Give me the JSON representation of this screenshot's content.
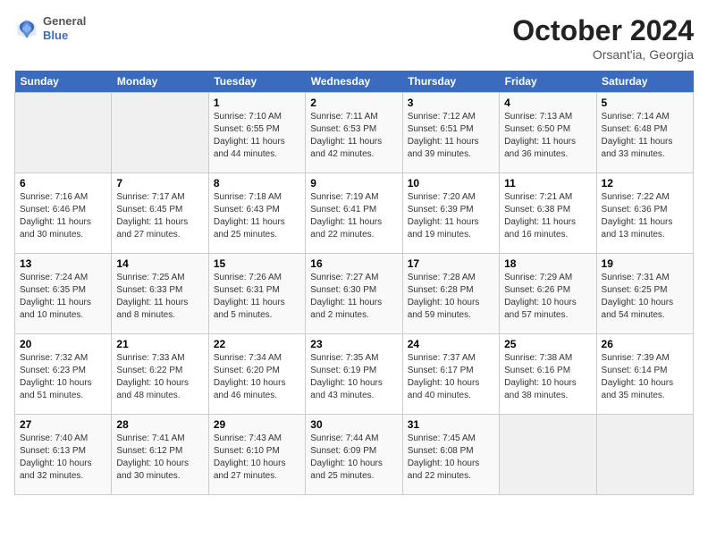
{
  "header": {
    "logo_general": "General",
    "logo_blue": "Blue",
    "month_title": "October 2024",
    "location": "Orsant'ia, Georgia"
  },
  "days_of_week": [
    "Sunday",
    "Monday",
    "Tuesday",
    "Wednesday",
    "Thursday",
    "Friday",
    "Saturday"
  ],
  "weeks": [
    [
      {
        "day": "",
        "empty": true
      },
      {
        "day": "",
        "empty": true
      },
      {
        "day": "1",
        "sunrise": "Sunrise: 7:10 AM",
        "sunset": "Sunset: 6:55 PM",
        "daylight": "Daylight: 11 hours and 44 minutes."
      },
      {
        "day": "2",
        "sunrise": "Sunrise: 7:11 AM",
        "sunset": "Sunset: 6:53 PM",
        "daylight": "Daylight: 11 hours and 42 minutes."
      },
      {
        "day": "3",
        "sunrise": "Sunrise: 7:12 AM",
        "sunset": "Sunset: 6:51 PM",
        "daylight": "Daylight: 11 hours and 39 minutes."
      },
      {
        "day": "4",
        "sunrise": "Sunrise: 7:13 AM",
        "sunset": "Sunset: 6:50 PM",
        "daylight": "Daylight: 11 hours and 36 minutes."
      },
      {
        "day": "5",
        "sunrise": "Sunrise: 7:14 AM",
        "sunset": "Sunset: 6:48 PM",
        "daylight": "Daylight: 11 hours and 33 minutes."
      }
    ],
    [
      {
        "day": "6",
        "sunrise": "Sunrise: 7:16 AM",
        "sunset": "Sunset: 6:46 PM",
        "daylight": "Daylight: 11 hours and 30 minutes."
      },
      {
        "day": "7",
        "sunrise": "Sunrise: 7:17 AM",
        "sunset": "Sunset: 6:45 PM",
        "daylight": "Daylight: 11 hours and 27 minutes."
      },
      {
        "day": "8",
        "sunrise": "Sunrise: 7:18 AM",
        "sunset": "Sunset: 6:43 PM",
        "daylight": "Daylight: 11 hours and 25 minutes."
      },
      {
        "day": "9",
        "sunrise": "Sunrise: 7:19 AM",
        "sunset": "Sunset: 6:41 PM",
        "daylight": "Daylight: 11 hours and 22 minutes."
      },
      {
        "day": "10",
        "sunrise": "Sunrise: 7:20 AM",
        "sunset": "Sunset: 6:39 PM",
        "daylight": "Daylight: 11 hours and 19 minutes."
      },
      {
        "day": "11",
        "sunrise": "Sunrise: 7:21 AM",
        "sunset": "Sunset: 6:38 PM",
        "daylight": "Daylight: 11 hours and 16 minutes."
      },
      {
        "day": "12",
        "sunrise": "Sunrise: 7:22 AM",
        "sunset": "Sunset: 6:36 PM",
        "daylight": "Daylight: 11 hours and 13 minutes."
      }
    ],
    [
      {
        "day": "13",
        "sunrise": "Sunrise: 7:24 AM",
        "sunset": "Sunset: 6:35 PM",
        "daylight": "Daylight: 11 hours and 10 minutes."
      },
      {
        "day": "14",
        "sunrise": "Sunrise: 7:25 AM",
        "sunset": "Sunset: 6:33 PM",
        "daylight": "Daylight: 11 hours and 8 minutes."
      },
      {
        "day": "15",
        "sunrise": "Sunrise: 7:26 AM",
        "sunset": "Sunset: 6:31 PM",
        "daylight": "Daylight: 11 hours and 5 minutes."
      },
      {
        "day": "16",
        "sunrise": "Sunrise: 7:27 AM",
        "sunset": "Sunset: 6:30 PM",
        "daylight": "Daylight: 11 hours and 2 minutes."
      },
      {
        "day": "17",
        "sunrise": "Sunrise: 7:28 AM",
        "sunset": "Sunset: 6:28 PM",
        "daylight": "Daylight: 10 hours and 59 minutes."
      },
      {
        "day": "18",
        "sunrise": "Sunrise: 7:29 AM",
        "sunset": "Sunset: 6:26 PM",
        "daylight": "Daylight: 10 hours and 57 minutes."
      },
      {
        "day": "19",
        "sunrise": "Sunrise: 7:31 AM",
        "sunset": "Sunset: 6:25 PM",
        "daylight": "Daylight: 10 hours and 54 minutes."
      }
    ],
    [
      {
        "day": "20",
        "sunrise": "Sunrise: 7:32 AM",
        "sunset": "Sunset: 6:23 PM",
        "daylight": "Daylight: 10 hours and 51 minutes."
      },
      {
        "day": "21",
        "sunrise": "Sunrise: 7:33 AM",
        "sunset": "Sunset: 6:22 PM",
        "daylight": "Daylight: 10 hours and 48 minutes."
      },
      {
        "day": "22",
        "sunrise": "Sunrise: 7:34 AM",
        "sunset": "Sunset: 6:20 PM",
        "daylight": "Daylight: 10 hours and 46 minutes."
      },
      {
        "day": "23",
        "sunrise": "Sunrise: 7:35 AM",
        "sunset": "Sunset: 6:19 PM",
        "daylight": "Daylight: 10 hours and 43 minutes."
      },
      {
        "day": "24",
        "sunrise": "Sunrise: 7:37 AM",
        "sunset": "Sunset: 6:17 PM",
        "daylight": "Daylight: 10 hours and 40 minutes."
      },
      {
        "day": "25",
        "sunrise": "Sunrise: 7:38 AM",
        "sunset": "Sunset: 6:16 PM",
        "daylight": "Daylight: 10 hours and 38 minutes."
      },
      {
        "day": "26",
        "sunrise": "Sunrise: 7:39 AM",
        "sunset": "Sunset: 6:14 PM",
        "daylight": "Daylight: 10 hours and 35 minutes."
      }
    ],
    [
      {
        "day": "27",
        "sunrise": "Sunrise: 7:40 AM",
        "sunset": "Sunset: 6:13 PM",
        "daylight": "Daylight: 10 hours and 32 minutes."
      },
      {
        "day": "28",
        "sunrise": "Sunrise: 7:41 AM",
        "sunset": "Sunset: 6:12 PM",
        "daylight": "Daylight: 10 hours and 30 minutes."
      },
      {
        "day": "29",
        "sunrise": "Sunrise: 7:43 AM",
        "sunset": "Sunset: 6:10 PM",
        "daylight": "Daylight: 10 hours and 27 minutes."
      },
      {
        "day": "30",
        "sunrise": "Sunrise: 7:44 AM",
        "sunset": "Sunset: 6:09 PM",
        "daylight": "Daylight: 10 hours and 25 minutes."
      },
      {
        "day": "31",
        "sunrise": "Sunrise: 7:45 AM",
        "sunset": "Sunset: 6:08 PM",
        "daylight": "Daylight: 10 hours and 22 minutes."
      },
      {
        "day": "",
        "empty": true
      },
      {
        "day": "",
        "empty": true
      }
    ]
  ]
}
